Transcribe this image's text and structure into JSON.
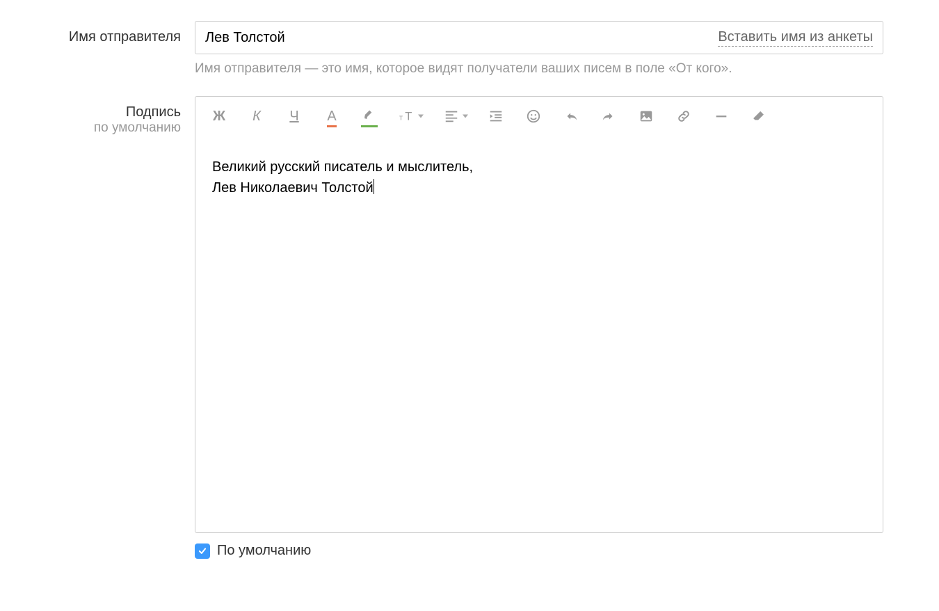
{
  "sender": {
    "label": "Имя отправителя",
    "value": "Лев Толстой",
    "insert_link": "Вставить имя из анкеты",
    "hint": "Имя отправителя — это имя, которое видят получатели ваших писем в поле «От кого»."
  },
  "signature": {
    "label_line1": "Подпись",
    "label_line2": "по умолчанию",
    "content_line1": "Великий русский писатель и мыслитель,",
    "content_line2": "Лев Николаевич Толстой",
    "default_checkbox_label": "По умолчанию",
    "default_checked": true
  },
  "toolbar": {
    "bold_glyph": "Ж",
    "italic_glyph": "К",
    "underline_glyph": "Ч",
    "text_color_glyph": "А",
    "text_color_underline": "#e8734a",
    "highlight_underline": "#6ab04c"
  }
}
